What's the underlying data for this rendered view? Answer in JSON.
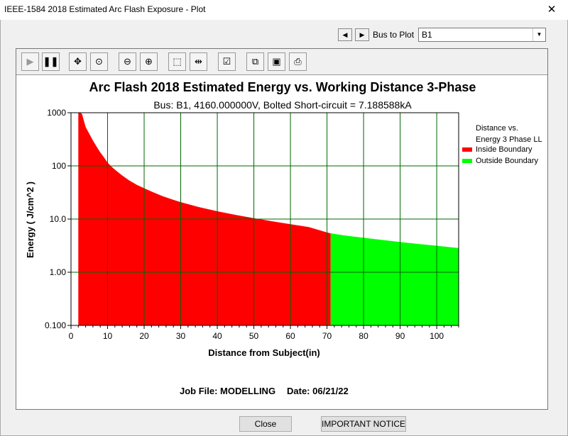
{
  "window": {
    "title": "IEEE-1584 2018 Estimated Arc Flash Exposure - Plot",
    "close_glyph": "✕"
  },
  "bus_selector": {
    "label": "Bus to Plot",
    "value": "B1"
  },
  "toolbar_icons": [
    "play-icon",
    "pause-icon",
    "pan-icon",
    "zoom-fit-icon",
    "zoom-out-icon",
    "zoom-in-icon",
    "select-box-icon",
    "split-icon",
    "properties-icon",
    "copy-icon",
    "save-icon",
    "print-icon"
  ],
  "chart_data": {
    "type": "area",
    "title": "Arc Flash 2018 Estimated Energy vs. Working Distance 3-Phase",
    "subtitle": "Bus: B1, 4160.000000V, Bolted Short-circuit = 7.188588kA",
    "xlabel": "Distance from Subject(in)",
    "ylabel": "Energy ( J/cm^2 )",
    "xscale": "linear",
    "yscale": "log",
    "xlim": [
      0,
      106
    ],
    "ylim": [
      0.1,
      1000
    ],
    "xticks": [
      "0",
      "10",
      "20",
      "30",
      "40",
      "50",
      "60",
      "70",
      "80",
      "90",
      "100"
    ],
    "yticks": [
      "0.100",
      "1.00",
      "10.0",
      "100",
      "1000"
    ],
    "grid": true,
    "legend_title": "Distance vs.\nEnergy 3 Phase LL",
    "legend_placement": "right",
    "boundary_x": 71,
    "series": [
      {
        "name": "Inside Boundary",
        "color": "#ff0000",
        "x": [
          2,
          2.5,
          3,
          4,
          5,
          6,
          7,
          8,
          9,
          10,
          11,
          12,
          14,
          16,
          18,
          20,
          22,
          25,
          28,
          30,
          35,
          40,
          45,
          50,
          55,
          60,
          65,
          70,
          71
        ],
        "y": [
          1000,
          1000,
          950,
          540,
          400,
          300,
          230,
          180,
          145,
          115,
          98,
          85,
          66,
          53,
          44,
          38,
          33,
          27,
          23,
          20.8,
          16.8,
          14.0,
          12.0,
          10.4,
          9.1,
          8.0,
          7.1,
          5.6,
          5.4
        ]
      },
      {
        "name": "Outside Boundary",
        "color": "#00ff00",
        "x": [
          71,
          75,
          80,
          85,
          90,
          95,
          100,
          106
        ],
        "y": [
          5.4,
          4.9,
          4.45,
          4.05,
          3.7,
          3.4,
          3.15,
          2.85
        ]
      }
    ]
  },
  "footer": {
    "job_label": "Job File: MODELLING",
    "date_label": "Date: 06/21/22"
  },
  "buttons": {
    "close": "Close",
    "notice": "IMPORTANT NOTICE"
  }
}
